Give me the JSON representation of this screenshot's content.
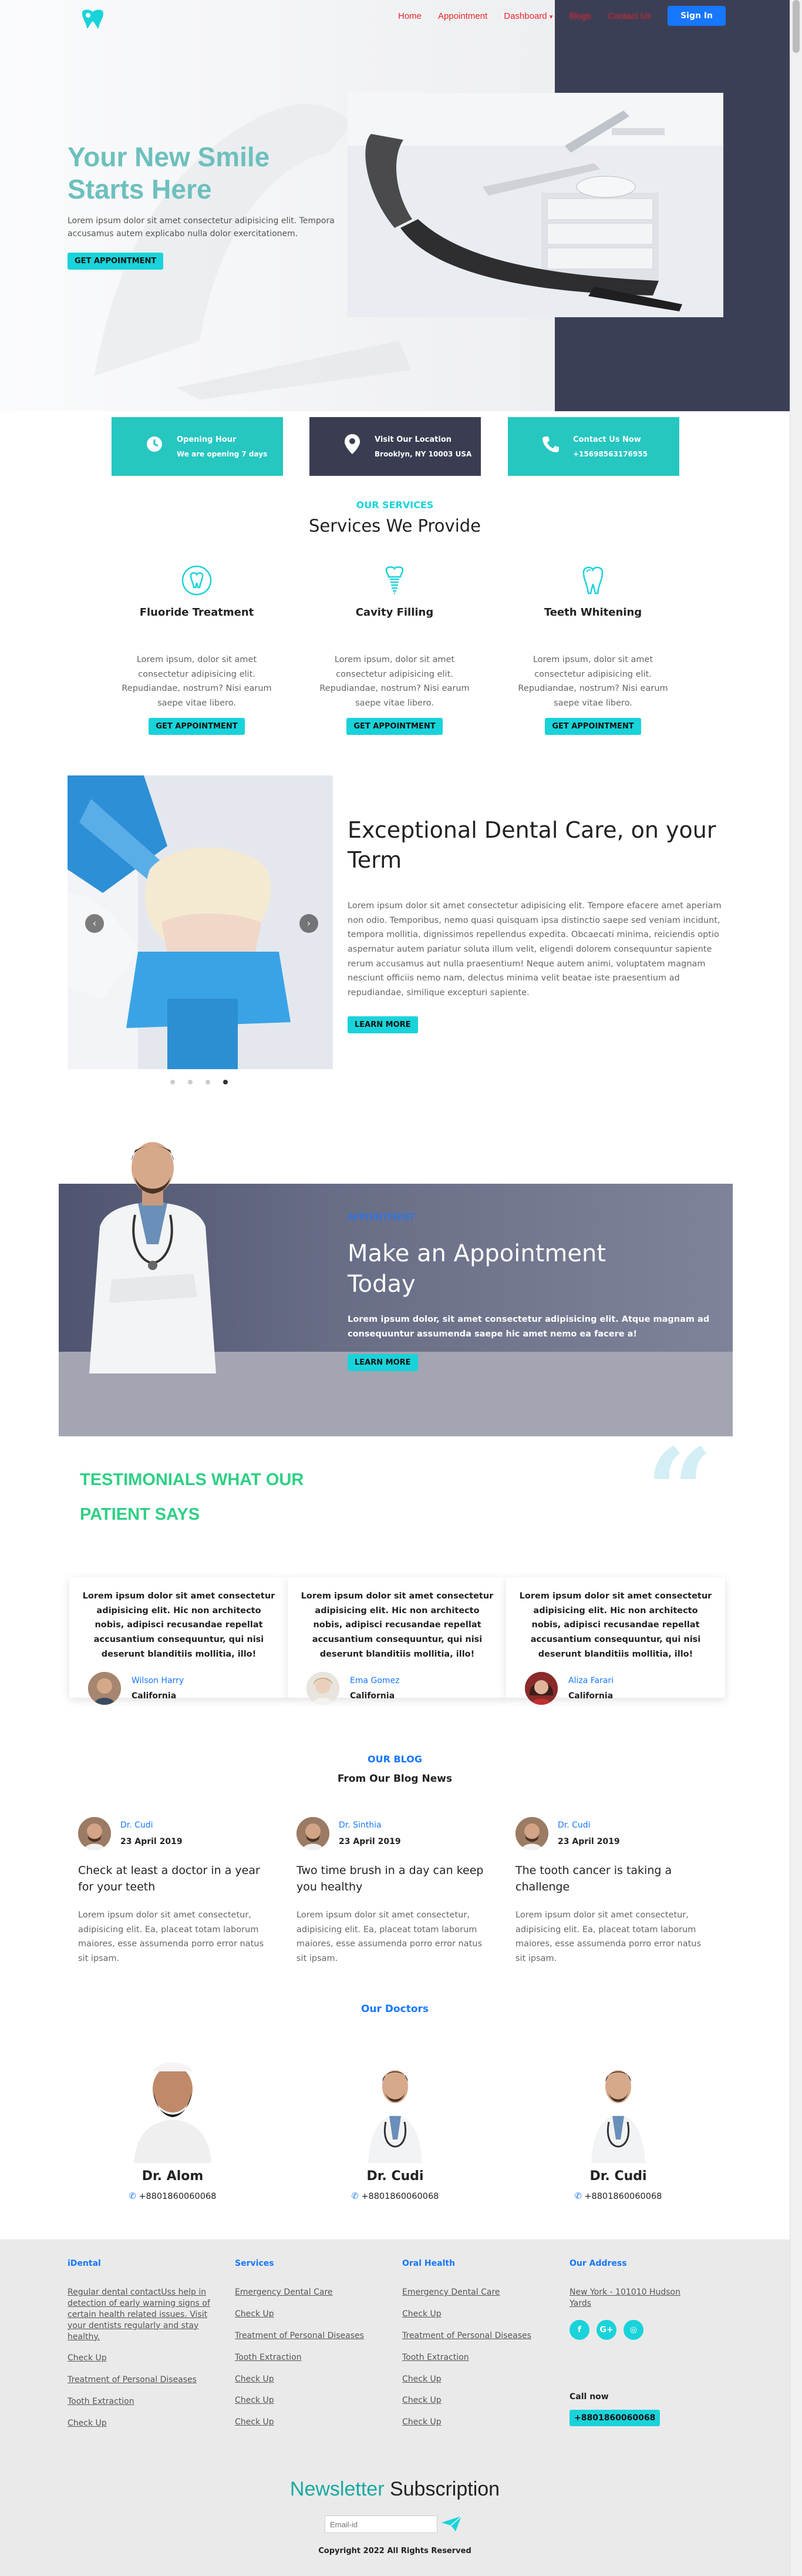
{
  "nav": {
    "items": [
      "Home",
      "Appointment",
      "Dashboard",
      "Blogs",
      "Contact Us"
    ],
    "signin": "Sign In"
  },
  "hero": {
    "title": "Your New Smile Starts Here",
    "text": "Lorem ipsum dolor sit amet consectetur adipisicing elit. Tempora accusamus autem explicabo nulla dolor exercitationem.",
    "button": "GET APPOINTMENT"
  },
  "info": [
    {
      "title": "Opening Hour",
      "sub": "We are opening 7 days",
      "icon": "clock-icon",
      "color": "#26c6c1"
    },
    {
      "title": "Visit Our Location",
      "sub": "Brooklyn, NY 10003 USA",
      "icon": "location-icon",
      "color": "#3a3d52"
    },
    {
      "title": "Contact Us Now",
      "sub": "+15698563176955",
      "icon": "phone-icon",
      "color": "#26c6c1"
    }
  ],
  "services": {
    "kicker": "OUR SERVICES",
    "title": "Services We Provide",
    "items": [
      {
        "name": "Fluoride Treatment",
        "desc": "Lorem ipsum, dolor sit amet consectetur adipisicing elit. Repudiandae, nostrum? Nisi earum saepe vitae libero.",
        "button": "GET APPOINTMENT"
      },
      {
        "name": "Cavity Filling",
        "desc": "Lorem ipsum, dolor sit amet consectetur adipisicing elit. Repudiandae, nostrum? Nisi earum saepe vitae libero.",
        "button": "GET APPOINTMENT"
      },
      {
        "name": "Teeth Whitening",
        "desc": "Lorem ipsum, dolor sit amet consectetur adipisicing elit. Repudiandae, nostrum? Nisi earum saepe vitae libero.",
        "button": "GET APPOINTMENT"
      }
    ]
  },
  "exceptional": {
    "title": "Exceptional Dental Care, on your Term",
    "text": "Lorem ipsum dolor sit amet consectetur adipisicing elit. Tempore efacere amet aperiam non odio. Temporibus, nemo quasi quisquam ipsa distinctio saepe sed veniam incidunt, tempora mollitia, dignissimos repellendus expedita. Obcaecati minima, reiciendis optio aspernatur autem pariatur soluta illum velit, eligendi dolorem consequuntur sapiente rerum accusamus aut nulla praesentium! Neque autem animi, voluptatem magnam nesciunt officiis nemo nam, delectus minima velit beatae iste praesentium ad repudiandae, similique excepturi sapiente.",
    "button": "LEARN MORE",
    "slides": 4,
    "active_slide": 4
  },
  "appointment": {
    "kicker": "APPOINTMENT",
    "title": "Make an Appointment Today",
    "text": "Lorem ipsum dolor, sit amet consectetur adipisicing elit. Atque magnam ad consequuntur assumenda saepe hic amet nemo ea facere a!",
    "button": "LEARN MORE"
  },
  "testimonials": {
    "title": "TESTIMONIALS WHAT OUR PATIENT SAYS",
    "items": [
      {
        "text": "Lorem ipsum dolor sit amet consectetur adipisicing elit. Hic non architecto nobis, adipisci recusandae repellat accusantium consequuntur, qui nisi deserunt blanditiis mollitia, illo!",
        "name": "Wilson Harry",
        "loc": "California"
      },
      {
        "text": "Lorem ipsum dolor sit amet consectetur adipisicing elit. Hic non architecto nobis, adipisci recusandae repellat accusantium consequuntur, qui nisi deserunt blanditiis mollitia, illo!",
        "name": "Ema Gomez",
        "loc": "California"
      },
      {
        "text": "Lorem ipsum dolor sit amet consectetur adipisicing elit. Hic non architecto nobis, adipisci recusandae repellat accusantium consequuntur, qui nisi deserunt blanditiis mollitia, illo!",
        "name": "Aliza Farari",
        "loc": "California"
      }
    ]
  },
  "blog": {
    "kicker": "OUR BLOG",
    "title": "From Our Blog News",
    "items": [
      {
        "author": "Dr. Cudi",
        "date": "23 April 2019",
        "title": "Check at least a doctor in a year for your teeth",
        "body": "Lorem ipsum dolor sit amet consectetur, adipisicing elit. Ea, placeat totam laborum maiores, esse assumenda porro error natus sit ipsam."
      },
      {
        "author": "Dr. Sinthia",
        "date": "23 April 2019",
        "title": "Two time brush in a day can keep you healthy",
        "body": "Lorem ipsum dolor sit amet consectetur, adipisicing elit. Ea, placeat totam laborum maiores, esse assumenda porro error natus sit ipsam."
      },
      {
        "author": "Dr. Cudi",
        "date": "23 April 2019",
        "title": "The tooth cancer is taking a challenge",
        "body": "Lorem ipsum dolor sit amet consectetur, adipisicing elit. Ea, placeat totam laborum maiores, esse assumenda porro error natus sit ipsam."
      }
    ]
  },
  "doctors": {
    "kicker": "Our Doctors",
    "items": [
      {
        "name": "Dr. Alom",
        "phone": "+8801860060068"
      },
      {
        "name": "Dr. Cudi",
        "phone": "+8801860060068"
      },
      {
        "name": "Dr. Cudi",
        "phone": "+8801860060068"
      }
    ]
  },
  "footer": {
    "col1": {
      "title": "iDental",
      "links": [
        "Regular dental contactUss help in detection of early warning signs of certain health related issues. Visit your dentists regularly and stay healthy.",
        "Check Up",
        "Treatment of Personal Diseases",
        "Tooth Extraction",
        "Check Up"
      ]
    },
    "col2": {
      "title": "Services",
      "links": [
        "Emergency Dental Care",
        "Check Up",
        "Treatment of Personal Diseases",
        "Tooth Extraction",
        "Check Up",
        "Check Up",
        "Check Up"
      ]
    },
    "col3": {
      "title": "Oral Health",
      "links": [
        "Emergency Dental Care",
        "Check Up",
        "Treatment of Personal Diseases",
        "Tooth Extraction",
        "Check Up",
        "Check Up",
        "Check Up"
      ]
    },
    "col4": {
      "title": "Our Address",
      "address": "New York - 101010 Hudson Yards"
    },
    "social": [
      "f",
      "G+",
      "◎"
    ],
    "callnow": "Call now",
    "callnum": "+8801860060068"
  },
  "newsletter": {
    "word1": "Newsletter",
    "word2": "Subscription",
    "placeholder": "Email-id"
  },
  "copyright": "Copyright 2022 All Rights Reserved",
  "colors": {
    "teal": "#19d3da",
    "blue": "#1677ff",
    "red": "#e8252b",
    "green": "#2ed084"
  }
}
